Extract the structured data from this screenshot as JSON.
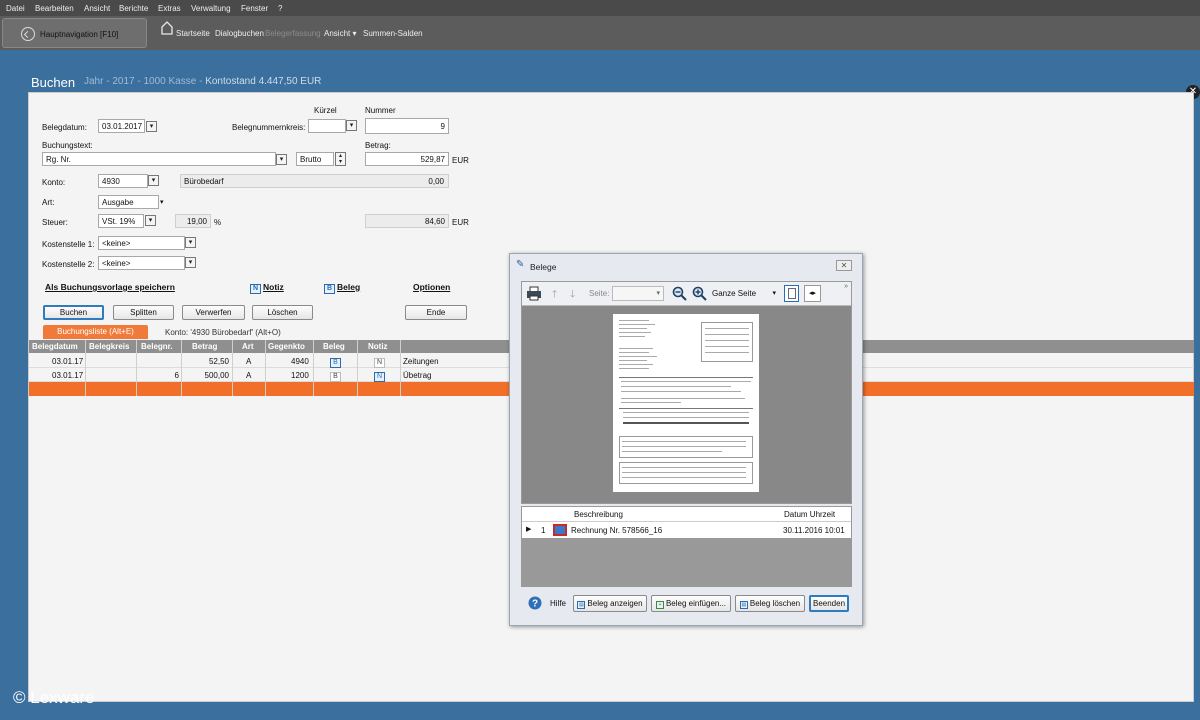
{
  "menu": [
    "Datei",
    "Bearbeiten",
    "Ansicht",
    "Berichte",
    "Extras",
    "Verwaltung",
    "Fenster",
    "?"
  ],
  "toolbar": {
    "nav_label": "Hauptnavigation [F10]",
    "items": [
      "Startseite",
      "Dialogbuchen",
      "Belegerfassung",
      "Ansicht ▾",
      "Summen-Salden"
    ]
  },
  "header": {
    "title": "Buchen",
    "jahr": "Jahr",
    "year": "2017",
    "kasse": "1000 Kasse",
    "kontostand": "Kontostand 4.447,50 EUR"
  },
  "form": {
    "kuerzel_label": "Kürzel",
    "nummer_label": "Nummer",
    "belegdatum_label": "Belegdatum:",
    "belegdatum_value": "03.01.2017",
    "belegnummernkreis_label": "Belegnummernkreis:",
    "nummer_value": "9",
    "buchungstext_label": "Buchungstext:",
    "buchungstext_value": "Rg. Nr.",
    "brutto_value": "Brutto",
    "betrag_label": "Betrag:",
    "betrag_value": "529,87",
    "eur1": "EUR",
    "konto_label": "Konto:",
    "konto_value": "4930",
    "konto_name": "Bürobedarf",
    "konto_saldo": "0,00",
    "art_label": "Art:",
    "art_value": "Ausgabe",
    "steuer_label": "Steuer:",
    "steuer_value": "VSt. 19%",
    "steuer_rate": "19,00",
    "percent": "%",
    "steuer_betrag": "84,60",
    "eur2": "EUR",
    "kostenstelle1_label": "Kostenstelle 1:",
    "kostenstelle1_value": "<keine>",
    "kostenstelle2_label": "Kostenstelle 2:",
    "kostenstelle2_value": "<keine>"
  },
  "links": {
    "vorlage": "Als Buchungsvorlage speichern",
    "notiz": "Notiz",
    "beleg": "Beleg",
    "optionen": "Optionen"
  },
  "buttons": {
    "buchen": "Buchen",
    "splitten": "Splitten",
    "verwerfen": "Verwerfen",
    "loeschen": "Löschen",
    "ende": "Ende"
  },
  "tabs": {
    "buchungsliste": "Buchungsliste (Alt+E)",
    "konto": "Konto: '4930 Bürobedarf' (Alt+O)"
  },
  "table": {
    "headers": [
      "Belegdatum",
      "Belegkreis",
      "Belegnr.",
      "Betrag",
      "Art",
      "Gegenkto",
      "Beleg",
      "Notiz"
    ],
    "rows": [
      {
        "datum": "03.01.17",
        "kreis": "",
        "nr": "",
        "betrag": "52,50",
        "art": "A",
        "gegenkto": "4940",
        "beleg": "B",
        "notiz": "N",
        "text": "Zeitungen"
      },
      {
        "datum": "03.01.17",
        "kreis": "",
        "nr": "6",
        "betrag": "500,00",
        "art": "A",
        "gegenkto": "1200",
        "beleg": "B",
        "notiz": "N",
        "text": "Übetrag"
      }
    ]
  },
  "dialog": {
    "title": "Belege",
    "seite_label": "Seite:",
    "zoom_value": "Ganze Seite",
    "list_headers": [
      "Beschreibung",
      "Datum Uhrzeit"
    ],
    "list_row": {
      "index": "1",
      "beschreibung": "Rechnung Nr. 578566_16",
      "datum": "30.11.2016 10:01"
    },
    "hilfe": "Hilfe",
    "buttons": [
      "Beleg anzeigen",
      "Beleg einfügen...",
      "Beleg löschen",
      "Beenden"
    ]
  },
  "watermark": "© Lexware",
  "colors": {
    "accent_orange": "#f26f2a",
    "header_blue": "#3a6f9e",
    "dialog_blue": "#2a6cb0"
  }
}
